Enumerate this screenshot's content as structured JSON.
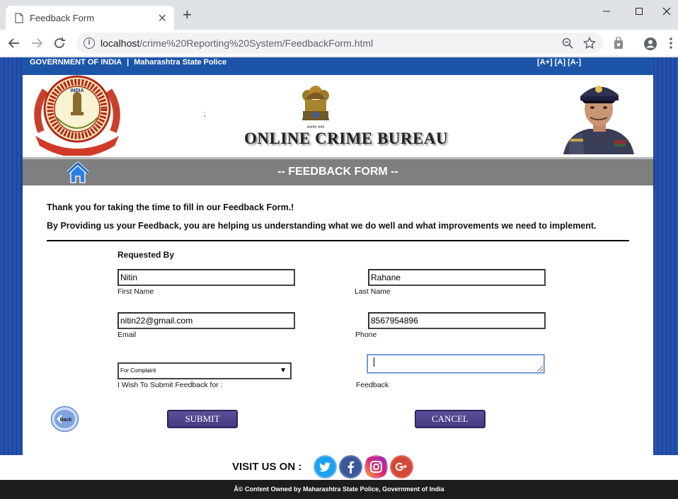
{
  "browser": {
    "tab_title": "Feedback Form",
    "new_tab": "+",
    "url_host": "localhost",
    "url_rest": "/crime%20Reporting%20System/FeedbackForm.html"
  },
  "govbar": {
    "left": "GOVERNMENT OF INDIA",
    "sep": "|",
    "right": "Maharashtra State Police",
    "font_plus": "[A+]",
    "font_normal": "[A]",
    "font_minus": "[A-]"
  },
  "header": {
    "semicolon": ";",
    "brand": "ONLINE CRIME BUREAU",
    "cbi_logo_top": "INDIA",
    "emblem_motto": "सत्यमेव जयते"
  },
  "title": "-- FEEDBACK FORM --",
  "intro": {
    "line1": "Thank you for taking the time to fill in our Feedback Form.!",
    "line2": "By Providing us your Feedback, you are helping us understanding what we do well and what improvements we need to implement."
  },
  "form": {
    "requested_by": "Requested By",
    "first_name": {
      "value": "Nitin",
      "label": "First Name"
    },
    "last_name": {
      "value": "Rahane",
      "label": "Last Name"
    },
    "email": {
      "value": "nitin22@gmail.com",
      "label": "Email"
    },
    "phone": {
      "value": "8567954896",
      "label": "Phone"
    },
    "feedback_for": {
      "value": "For Complaint",
      "label": "I Wish To Submit Feedback for :"
    },
    "feedback": {
      "value": "",
      "label": "Feedback"
    },
    "back_label": "Back",
    "submit": "SUBMIT",
    "cancel": "CANCEL"
  },
  "footer": {
    "visit": "VISIT US ON :",
    "copyright": "Â© Content Owned by Maharashtra State Police, Government of India"
  },
  "colors": {
    "govbar": "#1c55a8",
    "titlebar": "#7f7f7f",
    "button": "#4f438c",
    "twitter": "#1da1f2",
    "facebook": "#3b5998",
    "instagram": "#c13584",
    "googleplus": "#d34836"
  }
}
